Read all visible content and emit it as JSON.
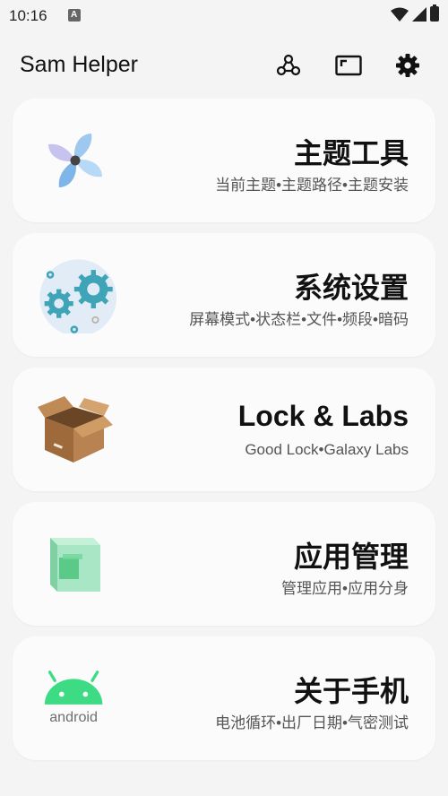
{
  "status_bar": {
    "time": "10:16"
  },
  "app_bar": {
    "title": "Sam Helper",
    "actions": [
      {
        "icon": "share-network-icon"
      },
      {
        "icon": "screen-frame-icon"
      },
      {
        "icon": "gear-icon"
      }
    ]
  },
  "cards": [
    {
      "title": "主题工具",
      "subtitle": "当前主题•主题路径•主题安装",
      "icon": "pinwheel-icon"
    },
    {
      "title": "系统设置",
      "subtitle": "屏幕模式•状态栏•文件•频段•暗码",
      "icon": "gears-icon"
    },
    {
      "title": "Lock & Labs",
      "subtitle": "Good Lock•Galaxy Labs",
      "icon": "box-icon"
    },
    {
      "title": "应用管理",
      "subtitle": "管理应用•应用分身",
      "icon": "cube-icon"
    },
    {
      "title": "关于手机",
      "subtitle": "电池循环•出厂日期•气密测试",
      "icon": "android-icon",
      "icon_text": "android"
    }
  ],
  "colors": {
    "background": "#f4f4f4",
    "card": "#fbfbfb",
    "android_green": "#3ddc84"
  }
}
